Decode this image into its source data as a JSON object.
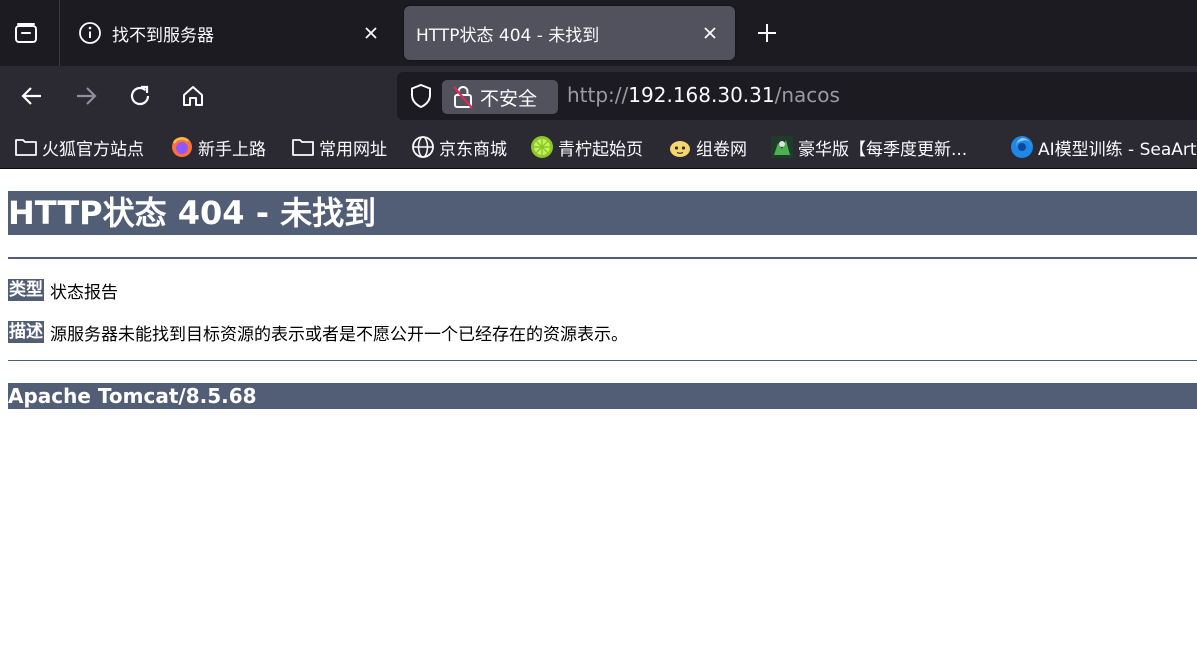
{
  "tabs": [
    {
      "title": "找不到服务器",
      "icon": "info-icon",
      "active": false
    },
    {
      "title": "HTTP状态 404 - 未找到",
      "active": true
    }
  ],
  "nav": {
    "identity_label": "不安全",
    "url_scheme": "http://",
    "url_host": "192.168.30.31",
    "url_path": "/nacos"
  },
  "bookmarks": [
    {
      "label": "火狐官方站点",
      "icon": "folder-icon"
    },
    {
      "label": "新手上路",
      "icon": "firefox-icon"
    },
    {
      "label": "常用网址",
      "icon": "folder-icon"
    },
    {
      "label": "京东商城",
      "icon": "globe-icon"
    },
    {
      "label": "青柠起始页",
      "icon": "lime-icon"
    },
    {
      "label": "组卷网",
      "icon": "face-icon"
    },
    {
      "label": "豪华版【每季度更新...",
      "icon": "game-icon"
    },
    {
      "label": "AI模型训练 - SeaArt",
      "icon": "seaart-icon"
    }
  ],
  "page": {
    "heading": "HTTP状态 404 - 未找到",
    "type_label": "类型",
    "type_value": "状态报告",
    "desc_label": "描述",
    "desc_value": "源服务器未能找到目标资源的表示或者是不愿公开一个已经存在的资源表示。",
    "footer": "Apache Tomcat/8.5.68"
  },
  "colors": {
    "tomcat_header": "#525d76",
    "browser_dark": "#1c1b22",
    "browser_toolbar": "#2b2a33"
  }
}
